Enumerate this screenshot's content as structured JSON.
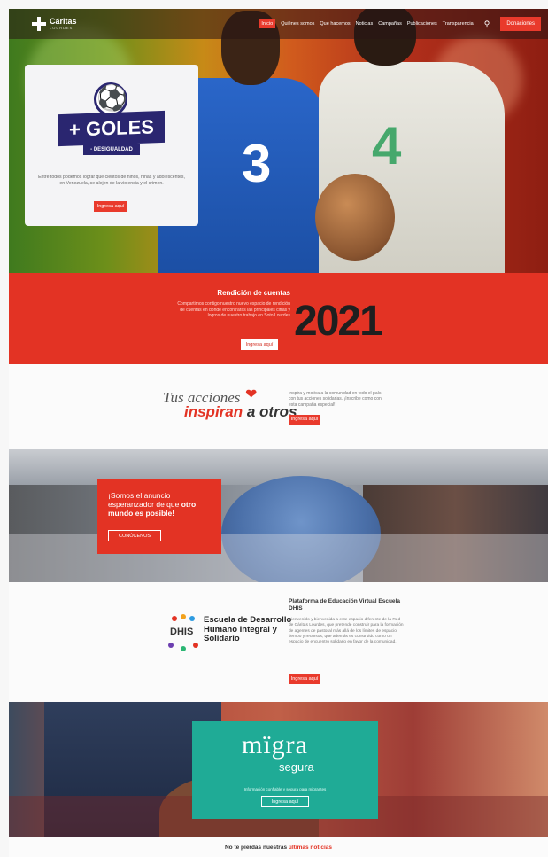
{
  "nav": {
    "brand": "Cáritas",
    "brand_sub": "LOURDES",
    "items": [
      "Inicio",
      "Quiénes somos",
      "Qué hacemos",
      "Noticias",
      "Campañas",
      "Publicaciones",
      "Transparencia"
    ],
    "donate_label": "Donaciones"
  },
  "hero": {
    "goles_title": "+ GOLES",
    "goles_sub": "- DESIGUALDAD",
    "text": "Entre todos podemos lograr que cientos de niños, niñas y adolescentes, en Venezuela, se alejen de la violencia y el crimen.",
    "button": "Ingresa aquí",
    "shirt_number_left": "3",
    "shirt_number_right": "4"
  },
  "rendicion": {
    "title": "Rendición de cuentas",
    "text": "Compartimos contigo nuestro nuevo espacio de rendición de cuentas en donde encontrarás las principales cifras y logros de nuestro trabajo en Soto Lourdes",
    "button": "Ingresa aquí",
    "year": "2021"
  },
  "acciones": {
    "line1": "Tus acciones",
    "line2_a": "inspiran",
    "line2_b": " a otros",
    "text": "Inspira y motiva a la comunidad en todo el país con tus acciones solidarias. ¡Inscribe como con esta campaña especial!",
    "button": "Ingresa aquí"
  },
  "anuncio": {
    "text_a": "¡Somos el anuncio esperanzador de que ",
    "text_b": "otro mundo es posible!",
    "button": "CONÓCENOS"
  },
  "dhis": {
    "logo_word": "DHIS",
    "logo_name": "Escuela de Desarrollo Humano Integral y Solidario",
    "title": "Plataforma de Educación Virtual Escuela DHIS",
    "text": "Bienvenido y bienvenida a este espacio diferente de la Red de Cáritas Lourdes, que pretende construir para la formación de agentes de pastoral más allá de los límites de espacio, tiempo y recursos, que además es construido como un espacio de encuentro solidario en favor de la comunidad.",
    "button": "Ingresa aquí"
  },
  "migra": {
    "logo_a": "mïgra",
    "logo_b": "segura",
    "info": "Información confiable y segura para migrantes",
    "button": "Ingresa aquí"
  },
  "footer": {
    "text_a": "No te pierdas nuestras ",
    "text_b": "últimas noticias"
  },
  "colors": {
    "brand_red": "#e33324",
    "goles_navy": "#2a2670",
    "migra_teal": "#1fab96"
  }
}
